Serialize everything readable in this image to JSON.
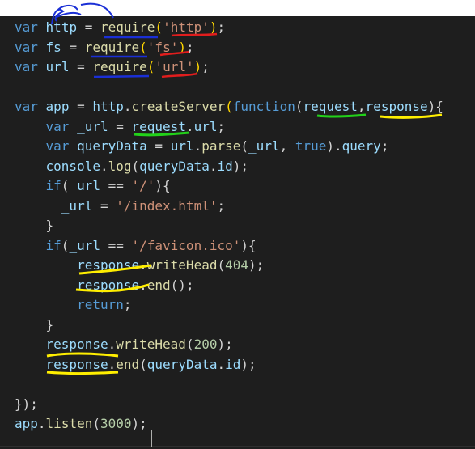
{
  "editor": {
    "lines": [
      [
        {
          "t": "var",
          "c": "kw"
        },
        {
          "t": " "
        },
        {
          "t": "http",
          "c": "var"
        },
        {
          "t": " = "
        },
        {
          "t": "require",
          "c": "fn"
        },
        {
          "t": "(",
          "c": "br"
        },
        {
          "t": "'http'",
          "c": "str"
        },
        {
          "t": ")",
          "c": "br"
        },
        {
          "t": ";"
        }
      ],
      [
        {
          "t": "var",
          "c": "kw"
        },
        {
          "t": " "
        },
        {
          "t": "fs",
          "c": "var"
        },
        {
          "t": " = "
        },
        {
          "t": "require",
          "c": "fn"
        },
        {
          "t": "(",
          "c": "br"
        },
        {
          "t": "'fs'",
          "c": "str"
        },
        {
          "t": ")",
          "c": "br"
        },
        {
          "t": ";"
        }
      ],
      [
        {
          "t": "var",
          "c": "kw"
        },
        {
          "t": " "
        },
        {
          "t": "url",
          "c": "var"
        },
        {
          "t": " = "
        },
        {
          "t": "require",
          "c": "fn"
        },
        {
          "t": "(",
          "c": "br"
        },
        {
          "t": "'url'",
          "c": "str"
        },
        {
          "t": ")",
          "c": "br"
        },
        {
          "t": ";"
        }
      ],
      [],
      [
        {
          "t": "var",
          "c": "kw"
        },
        {
          "t": " "
        },
        {
          "t": "app",
          "c": "var"
        },
        {
          "t": " = "
        },
        {
          "t": "http",
          "c": "var"
        },
        {
          "t": "."
        },
        {
          "t": "createServer",
          "c": "fn"
        },
        {
          "t": "(",
          "c": "br"
        },
        {
          "t": "function",
          "c": "kw"
        },
        {
          "t": "("
        },
        {
          "t": "request",
          "c": "var"
        },
        {
          "t": ","
        },
        {
          "t": "response",
          "c": "var"
        },
        {
          "t": "){"
        }
      ],
      [
        {
          "t": "    "
        },
        {
          "t": "var",
          "c": "kw"
        },
        {
          "t": " "
        },
        {
          "t": "_url",
          "c": "var"
        },
        {
          "t": " = "
        },
        {
          "t": "request",
          "c": "var"
        },
        {
          "t": "."
        },
        {
          "t": "url",
          "c": "var"
        },
        {
          "t": ";"
        }
      ],
      [
        {
          "t": "    "
        },
        {
          "t": "var",
          "c": "kw"
        },
        {
          "t": " "
        },
        {
          "t": "queryData",
          "c": "var"
        },
        {
          "t": " = "
        },
        {
          "t": "url",
          "c": "var"
        },
        {
          "t": "."
        },
        {
          "t": "parse",
          "c": "fn"
        },
        {
          "t": "("
        },
        {
          "t": "_url",
          "c": "var"
        },
        {
          "t": ", "
        },
        {
          "t": "true",
          "c": "kw"
        },
        {
          "t": ")."
        },
        {
          "t": "query",
          "c": "var"
        },
        {
          "t": ";"
        }
      ],
      [
        {
          "t": "    "
        },
        {
          "t": "console",
          "c": "var"
        },
        {
          "t": "."
        },
        {
          "t": "log",
          "c": "fn"
        },
        {
          "t": "("
        },
        {
          "t": "queryData",
          "c": "var"
        },
        {
          "t": "."
        },
        {
          "t": "id",
          "c": "var"
        },
        {
          "t": ");"
        }
      ],
      [
        {
          "t": "    "
        },
        {
          "t": "if",
          "c": "kw"
        },
        {
          "t": "("
        },
        {
          "t": "_url",
          "c": "var"
        },
        {
          "t": " == "
        },
        {
          "t": "'/'",
          "c": "str"
        },
        {
          "t": "){"
        }
      ],
      [
        {
          "t": "      "
        },
        {
          "t": "_url",
          "c": "var"
        },
        {
          "t": " = "
        },
        {
          "t": "'/index.html'",
          "c": "str"
        },
        {
          "t": ";"
        }
      ],
      [
        {
          "t": "    }"
        }
      ],
      [
        {
          "t": "    "
        },
        {
          "t": "if",
          "c": "kw"
        },
        {
          "t": "("
        },
        {
          "t": "_url",
          "c": "var"
        },
        {
          "t": " == "
        },
        {
          "t": "'/favicon.ico'",
          "c": "str"
        },
        {
          "t": "){"
        }
      ],
      [
        {
          "t": "        "
        },
        {
          "t": "response",
          "c": "var"
        },
        {
          "t": "."
        },
        {
          "t": "writeHead",
          "c": "fn"
        },
        {
          "t": "("
        },
        {
          "t": "404",
          "c": "num"
        },
        {
          "t": ");"
        }
      ],
      [
        {
          "t": "        "
        },
        {
          "t": "response",
          "c": "var"
        },
        {
          "t": "."
        },
        {
          "t": "end",
          "c": "fn"
        },
        {
          "t": "();"
        }
      ],
      [
        {
          "t": "        "
        },
        {
          "t": "return",
          "c": "kw"
        },
        {
          "t": ";"
        }
      ],
      [
        {
          "t": "    }"
        }
      ],
      [
        {
          "t": "    "
        },
        {
          "t": "response",
          "c": "var"
        },
        {
          "t": "."
        },
        {
          "t": "writeHead",
          "c": "fn"
        },
        {
          "t": "("
        },
        {
          "t": "200",
          "c": "num"
        },
        {
          "t": ");"
        }
      ],
      [
        {
          "t": "    "
        },
        {
          "t": "response",
          "c": "var"
        },
        {
          "t": "."
        },
        {
          "t": "end",
          "c": "fn"
        },
        {
          "t": "("
        },
        {
          "t": "queryData",
          "c": "var"
        },
        {
          "t": "."
        },
        {
          "t": "id",
          "c": "var"
        },
        {
          "t": ");"
        }
      ],
      [],
      [
        {
          "t": "});"
        }
      ],
      [
        {
          "t": "app",
          "c": "var"
        },
        {
          "t": "."
        },
        {
          "t": "listen",
          "c": "fn"
        },
        {
          "t": "("
        },
        {
          "t": "3000",
          "c": "num"
        },
        {
          "t": ");"
        }
      ]
    ]
  },
  "colors": {
    "background": "#1e1e1e",
    "keyword": "#569cd6",
    "string": "#ce9178",
    "number": "#b5cea8",
    "function": "#dcdcaa",
    "variable": "#9cdcfe",
    "annotation_blue": "#1a2fd6",
    "annotation_red": "#e11d1d",
    "annotation_green": "#22d11a",
    "annotation_yellow": "#ffee00"
  }
}
